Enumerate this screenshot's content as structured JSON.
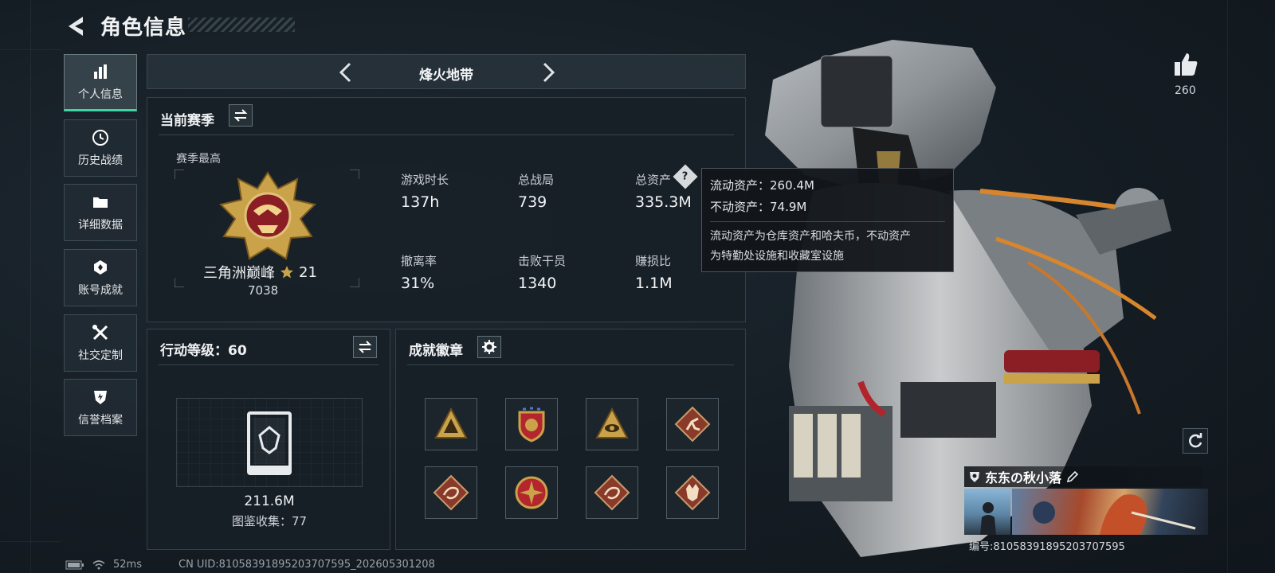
{
  "header": {
    "title": "角色信息",
    "back_icon": "back-arrow-icon"
  },
  "sidebar": {
    "items": [
      {
        "label": "个人信息",
        "icon": "bar-chart-icon",
        "active": true
      },
      {
        "label": "历史战绩",
        "icon": "history-clock-icon",
        "active": false
      },
      {
        "label": "详细数据",
        "icon": "folder-icon",
        "active": false
      },
      {
        "label": "账号成就",
        "icon": "achievement-badge-icon",
        "active": false
      },
      {
        "label": "社交定制",
        "icon": "tools-icon",
        "active": false
      },
      {
        "label": "信誉档案",
        "icon": "shield-credit-icon",
        "active": false
      }
    ]
  },
  "mode": {
    "name": "烽火地带"
  },
  "season": {
    "title": "当前赛季",
    "best_label": "赛季最高",
    "rank_name": "三角洲巅峰",
    "rank_stars": "21",
    "rank_score": "7038",
    "stats": [
      {
        "label": "游戏时长",
        "value": "137h"
      },
      {
        "label": "总战局",
        "value": "739"
      },
      {
        "label": "总资产",
        "value": "335.3M"
      },
      {
        "label": "撤离率",
        "value": "31%"
      },
      {
        "label": "击败干员",
        "value": "1340"
      },
      {
        "label": "赚损比",
        "value": "1.1M"
      }
    ]
  },
  "tooltip": {
    "liquid": "流动资产：260.4M",
    "fixed": "不动资产：74.9M",
    "description_line1": "流动资产为仓库资产和哈夫币，不动资产",
    "description_line2": "为特勤处设施和收藏室设施"
  },
  "action_level": {
    "title": "行动等级：60",
    "value": "211.6M",
    "collection": "图鉴收集：77"
  },
  "achievements": {
    "title": "成就徽章",
    "badges": [
      "triangle-badge-icon",
      "shield-emblem-icon",
      "triangle-eye-icon",
      "runner-badge-icon",
      "dragon-badge-icon",
      "compass-badge-icon",
      "dragon-badge-icon",
      "wolf-badge-icon"
    ]
  },
  "profile": {
    "likes": "260",
    "player_name": "东东の秋小落",
    "player_id": "编号:8105839189520370759​5"
  },
  "footer": {
    "ping": "52ms",
    "uid": "CN UID:8105839189520370759​5_202605301208"
  },
  "colors": {
    "accent": "#3fd7a1",
    "gold": "#c9a24a",
    "panel_bg": "#182027"
  }
}
